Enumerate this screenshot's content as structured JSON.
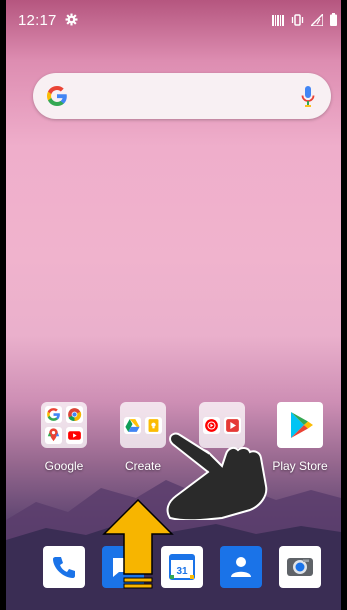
{
  "status_bar": {
    "time": "12:17",
    "icons": [
      "gear-icon",
      "nfc-icon",
      "vibrate-icon",
      "signal-icon",
      "battery-icon"
    ]
  },
  "search_bar": {
    "icons": [
      "google-g-icon",
      "microphone-icon"
    ]
  },
  "home_apps": [
    {
      "label": "Google",
      "type": "folder"
    },
    {
      "label": "Create",
      "type": "folder"
    },
    {
      "label": "",
      "type": "folder"
    },
    {
      "label": "Play Store",
      "type": "app"
    }
  ],
  "dock": [
    "phone-icon",
    "messages-icon",
    "calendar-icon",
    "contacts-icon",
    "camera-icon"
  ],
  "calendar_day": "31",
  "colors": {
    "wallpaper_top": "#b5567f",
    "wallpaper_mid": "#f0b3cd",
    "mountain": "#3a2d54",
    "arrow": "#f7b500",
    "hand": "#2a2a2a"
  }
}
